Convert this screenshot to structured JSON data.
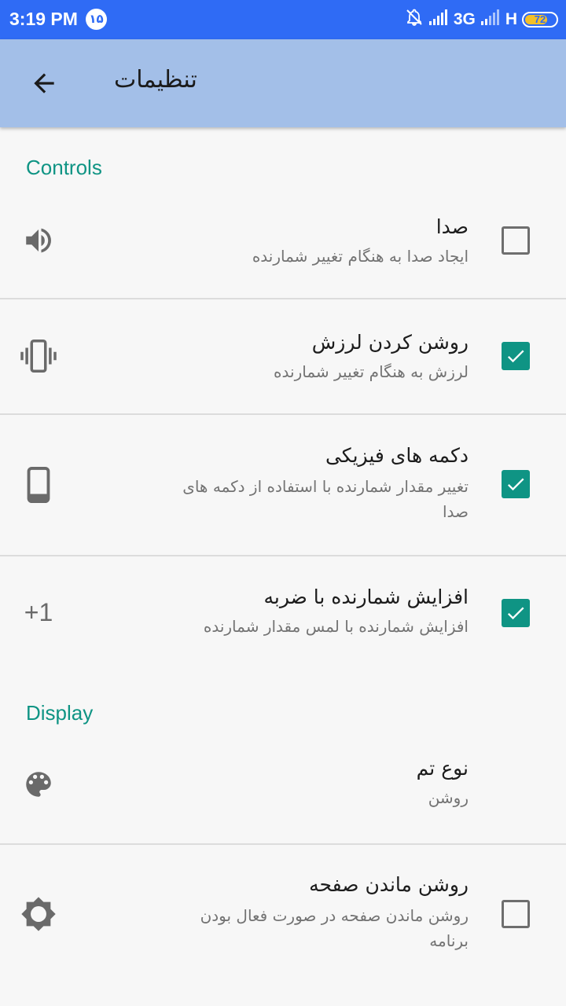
{
  "status_bar": {
    "time": "3:19 PM",
    "notification_badge": "۱۵",
    "network_3g": "3G",
    "network_h": "H",
    "battery_level": "72",
    "battery_fraction": 0.72,
    "battery_color": "#f4c027"
  },
  "app_bar": {
    "back_icon": "arrow-back-icon",
    "title": "تنظیمات"
  },
  "sections": {
    "controls": {
      "header": "Controls",
      "items": [
        {
          "icon": "volume-icon",
          "title": "صدا",
          "summary": "ایجاد صدا به هنگام تغییر شمارنده",
          "checked": false
        },
        {
          "icon": "vibration-icon",
          "title": "روشن کردن لرزش",
          "summary": "لرزش به هنگام تغییر شمارنده",
          "checked": true
        },
        {
          "icon": "phone-icon",
          "title": "دکمه های فیزیکی",
          "summary_line1": "تغییر مقدار شمارنده با استفاده از دکمه های",
          "summary_line2": "صدا",
          "checked": true
        },
        {
          "icon": "plus-one-icon",
          "icon_text": "+1",
          "title": "افزایش شمارنده با ضربه",
          "summary": "افزایش شمارنده با لمس مقدار شمارنده",
          "checked": true
        }
      ]
    },
    "display": {
      "header": "Display",
      "items": [
        {
          "icon": "palette-icon",
          "title": "نوع تم",
          "summary": "روشن"
        },
        {
          "icon": "brightness-icon",
          "title": "روشن ماندن صفحه",
          "summary_line1": "روشن ماندن صفحه در صورت فعال بودن",
          "summary_line2": "برنامه",
          "checked": false
        }
      ]
    }
  },
  "colors": {
    "status_bar": "#2f6bf5",
    "app_bar": "#a3bfe8",
    "accent": "#0f9484",
    "background": "#f7f7f7"
  }
}
